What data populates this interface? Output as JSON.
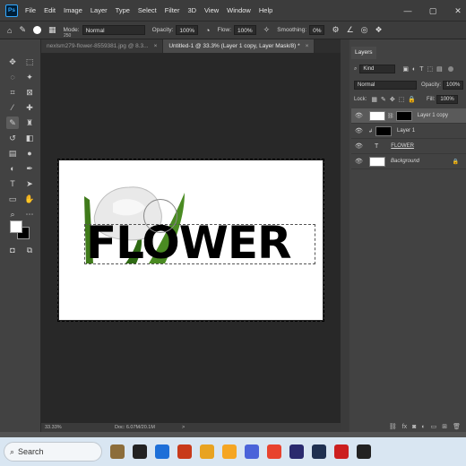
{
  "app": {
    "logo": "Ps",
    "menu": [
      "File",
      "Edit",
      "Image",
      "Layer",
      "Type",
      "Select",
      "Filter",
      "3D",
      "View",
      "Window",
      "Help"
    ],
    "window_controls": [
      "—",
      "▢",
      "✕"
    ]
  },
  "options": {
    "brush_size": "250",
    "mode_label": "Mode:",
    "mode_value": "Normal",
    "opacity_label": "Opacity:",
    "opacity_value": "100%",
    "flow_label": "Flow:",
    "flow_value": "100%",
    "smoothing_label": "Smoothing:",
    "smoothing_value": "0%"
  },
  "tabs": [
    {
      "label": "nexlsm279-flower-8559381.jpg @ 8.3...",
      "close": "×"
    },
    {
      "label": "Untitled-1 @ 33.3% (Layer 1 copy, Layer Mask/8) *",
      "close": "×"
    }
  ],
  "canvas": {
    "text": "FLOWER"
  },
  "status": {
    "zoom": "33.33%",
    "doc": "Doc: 6.07M/20.1M",
    "arrow": ">"
  },
  "layers_panel": {
    "tab": "Layers",
    "kind_label": "Kind",
    "blend_mode": "Normal",
    "opacity_label": "Opacity:",
    "opacity_value": "100%",
    "lock_label": "Lock:",
    "fill_label": "Fill:",
    "fill_value": "100%",
    "layers": [
      {
        "name": "Layer 1 copy",
        "selected": true
      },
      {
        "name": "Layer 1",
        "selected": false
      },
      {
        "name": "FLOWER",
        "selected": false
      },
      {
        "name": "Background",
        "selected": false
      }
    ]
  },
  "taskbar": {
    "search_label": "Search",
    "icon_colors": [
      "#8c6d3a",
      "#222222",
      "#1d6fd8",
      "#c83a1a",
      "#e8a321",
      "#f5a623",
      "#4a63d9",
      "#e8432e",
      "#2a2a6e",
      "#1f3050",
      "#cc1f1f",
      "#222222"
    ]
  }
}
